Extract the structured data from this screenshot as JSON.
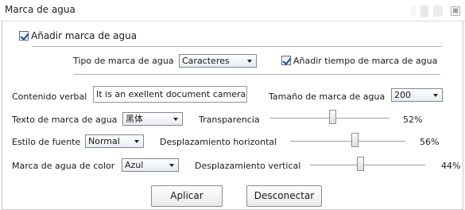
{
  "window": {
    "title": "Marca de agua",
    "close_glyph": "⊠"
  },
  "enable_watermark": {
    "label": "Añadir marca de agua",
    "checked": true
  },
  "type_row": {
    "label": "Tipo de marca de agua",
    "select_value": "Caracteres",
    "time_checkbox": {
      "label": "Añadir tiempo de marca de agua",
      "checked": true
    }
  },
  "content_row": {
    "label": "Contenido verbal",
    "value": "It is an exellent document camera",
    "size_label": "Tamaño de marca de agua",
    "size_value": "200"
  },
  "font_row": {
    "label": "Texto de marca de agua",
    "font_value": "黑体",
    "slider_label": "Transparencia",
    "slider_value_text": "52%",
    "slider_value": 0.52
  },
  "style_row": {
    "label": "Estilo de fuente",
    "style_value": "Normal",
    "slider_label": "Desplazamiento horizontal",
    "slider_value_text": "56%",
    "slider_value": 0.56
  },
  "color_row": {
    "label": "Marca de agua de color",
    "color_value": "Azul",
    "slider_label": "Desplazamiento vertical",
    "slider_value_text": "44%",
    "slider_value": 0.44
  },
  "buttons": {
    "apply": "Aplicar",
    "disconnect": "Desconectar"
  },
  "colors": {
    "accent": "#1f4aa8",
    "border": "#8c8c8c"
  }
}
